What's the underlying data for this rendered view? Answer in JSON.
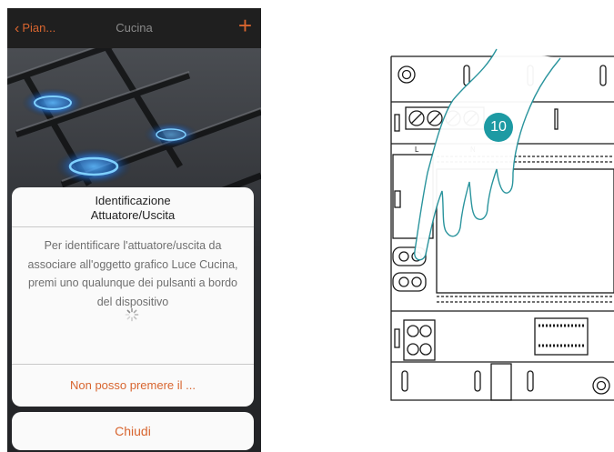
{
  "app": {
    "back_label": "Pian...",
    "title": "Cucina",
    "add_symbol": "+"
  },
  "dialog": {
    "title_line1": "Identificazione",
    "title_line2": "Attuatore/Uscita",
    "message": "Per identificare l'attuatore/uscita da associare all'oggetto grafico Luce Cucina, premi uno qualunque dei pulsanti a bordo del dispositivo",
    "cannot_press_label": "Non posso premere il ...",
    "close_label": "Chiudi"
  },
  "illustration": {
    "step_number": "10",
    "terminal_labels": [
      "L",
      "N"
    ]
  },
  "colors": {
    "accent": "#d8652f",
    "badge": "#1d9aa3",
    "topbar": "#1f1f1f"
  },
  "icons": {
    "back": "chevron-left-icon",
    "add": "plus-icon",
    "loading": "spinner-icon"
  }
}
